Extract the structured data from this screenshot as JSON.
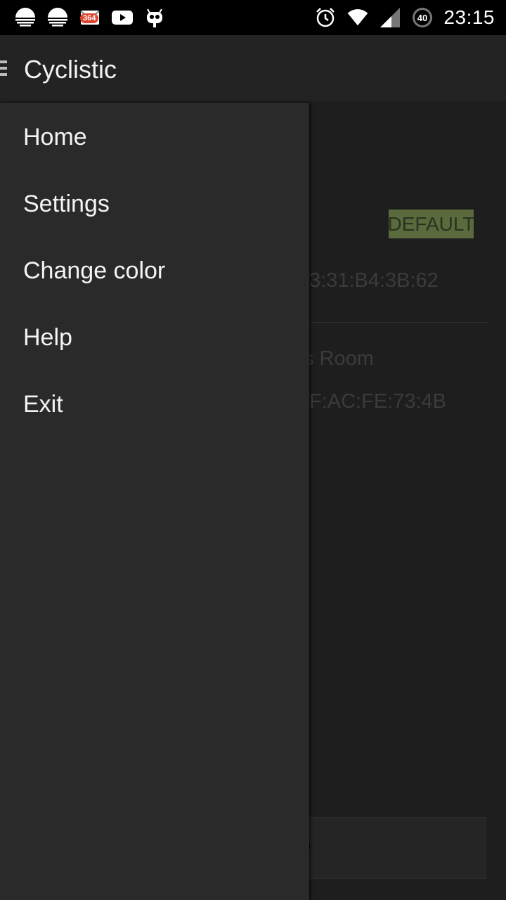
{
  "status_bar": {
    "left_icons": [
      "sun-icon",
      "sun-icon",
      "mail-icon",
      "youtube-icon",
      "cyanogen-mascot-icon"
    ],
    "mail_badge": "364",
    "right_icons": [
      "alarm-icon",
      "wifi-icon",
      "signal-icon",
      "battery-icon"
    ],
    "battery_level": "40",
    "time": "23:15"
  },
  "app_bar": {
    "title": "Cyclistic",
    "menu_icon": "hamburger-icon"
  },
  "drawer": {
    "items": [
      {
        "label": "Home"
      },
      {
        "label": "Settings"
      },
      {
        "label": "Change color"
      },
      {
        "label": "Help"
      },
      {
        "label": "Exit"
      }
    ]
  },
  "background": {
    "default_badge": "DEFAULT",
    "device1_address": "3:31:B4:3B:62",
    "device2_name": "s Room",
    "device2_address": "F:AC:FE:73:4B",
    "bottom_button": "e"
  },
  "colors": {
    "status_bar": "#000000",
    "app_bar": "#232323",
    "drawer": "#2a2a2a",
    "badge_bg": "#5a6a3c"
  }
}
